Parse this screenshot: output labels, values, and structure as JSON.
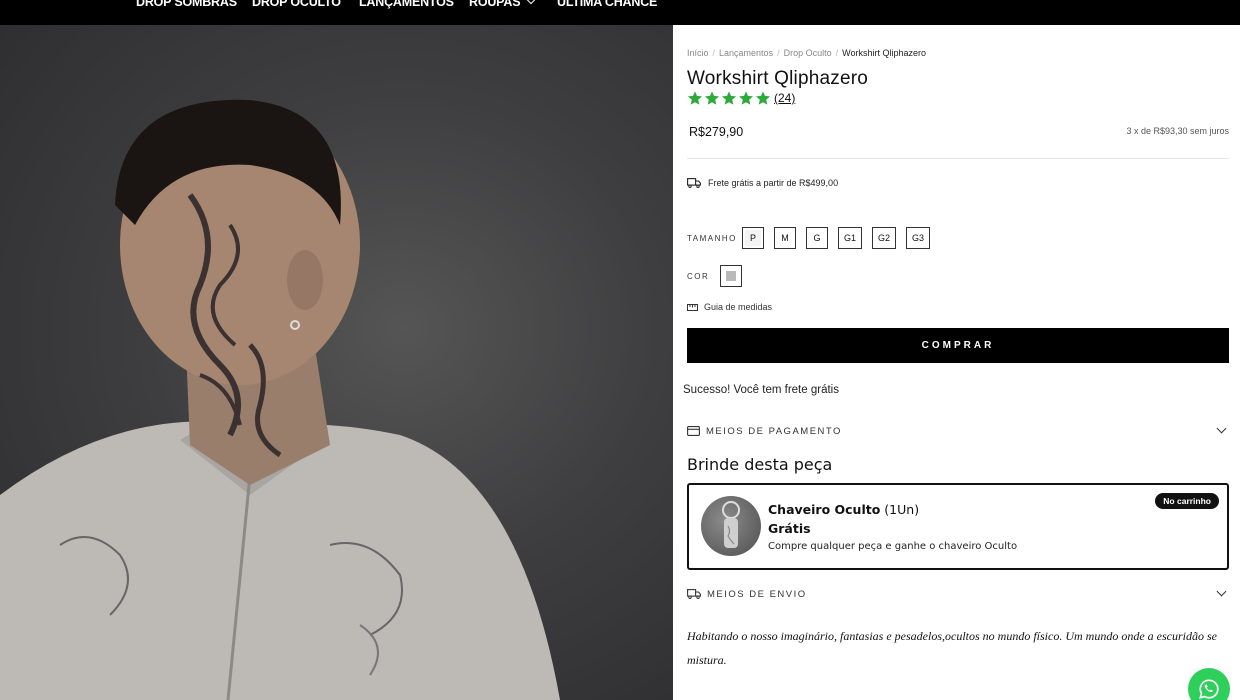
{
  "nav": {
    "items": [
      "DROP SOMBRAS",
      "DROP OCULTO",
      "LANÇAMENTOS",
      "ROUPAS",
      "ÚLTIMA CHANCE"
    ]
  },
  "breadcrumb": [
    "Início",
    "Lançamentos",
    "Drop Oculto",
    "Workshirt Qliphazero"
  ],
  "product": {
    "title": "Workshirt Qliphazero",
    "rating": 5,
    "reviews": "(24)",
    "price": "R$279,90",
    "installments": "3 x de R$93,30 sem juros",
    "free_shipping_note": "Frete grátis a partir de R$499,00"
  },
  "options": {
    "size_label": "TAMANHO",
    "sizes": [
      "P",
      "M",
      "G",
      "G1",
      "G2",
      "G3"
    ],
    "selected_size": "P",
    "color_label": "COR",
    "color_swatch": "#b9b9b9",
    "size_guide": "Guia de medidas"
  },
  "buy_label": "COMPRAR",
  "success_message": "Sucesso! Você tem frete grátis",
  "accordions": {
    "payment": "MEIOS DE PAGAMENTO",
    "shipping": "MEIOS DE ENVIO"
  },
  "gift": {
    "title": "Brinde desta peça",
    "name": "Chaveiro Oculto",
    "qty": "(1Un)",
    "price": "Grátis",
    "description": "Compre qualquer peça e ganhe o chaveiro Oculto",
    "badge": "No carrinho"
  },
  "description": "Habitando o nosso imaginário, fantasias e pesadelos,ocultos no mundo físico. Um mundo onde a escuridão se mistura.",
  "colors": {
    "nav_bg": "#000000",
    "star": "#2eaa3c",
    "buy_bg": "#000000",
    "whatsapp": "#2fcf5c"
  }
}
